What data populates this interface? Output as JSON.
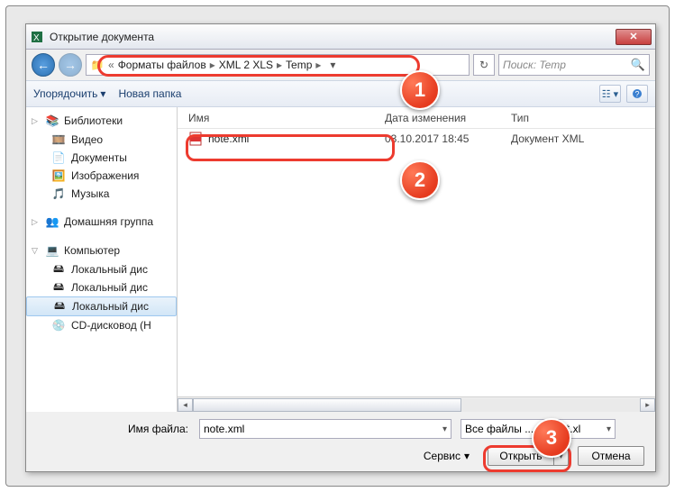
{
  "window": {
    "title": "Открытие документа"
  },
  "breadcrumbs": {
    "sep0": "«",
    "part1": "Форматы файлов",
    "part2": "XML 2 XLS",
    "part3": "Temp",
    "sep": "▸"
  },
  "search": {
    "placeholder": "Поиск: Temp"
  },
  "toolbar": {
    "organize": "Упорядочить",
    "newfolder": "Новая папка"
  },
  "sidebar": {
    "libs": "Библиотеки",
    "video": "Видео",
    "docs": "Документы",
    "images": "Изображения",
    "music": "Музыка",
    "homegroup": "Домашняя группа",
    "computer": "Компьютер",
    "disk1": "Локальный дис",
    "disk2": "Локальный дис",
    "disk3": "Локальный дис",
    "cd": "CD-дисковод (H"
  },
  "columns": {
    "name": "Имя",
    "date": "Дата изменения",
    "type": "Тип"
  },
  "file": {
    "name": "note.xml",
    "date": "03.10.2017 18:45",
    "type": "Документ XML"
  },
  "bottom": {
    "filename_label": "Имя файла:",
    "filename_value": "note.xml",
    "filetype_value": "Все файлы ... *.xlsx;*.xl",
    "service": "Сервис",
    "open": "Открыть",
    "cancel": "Отмена"
  },
  "annotations": {
    "1": "1",
    "2": "2",
    "3": "3"
  }
}
